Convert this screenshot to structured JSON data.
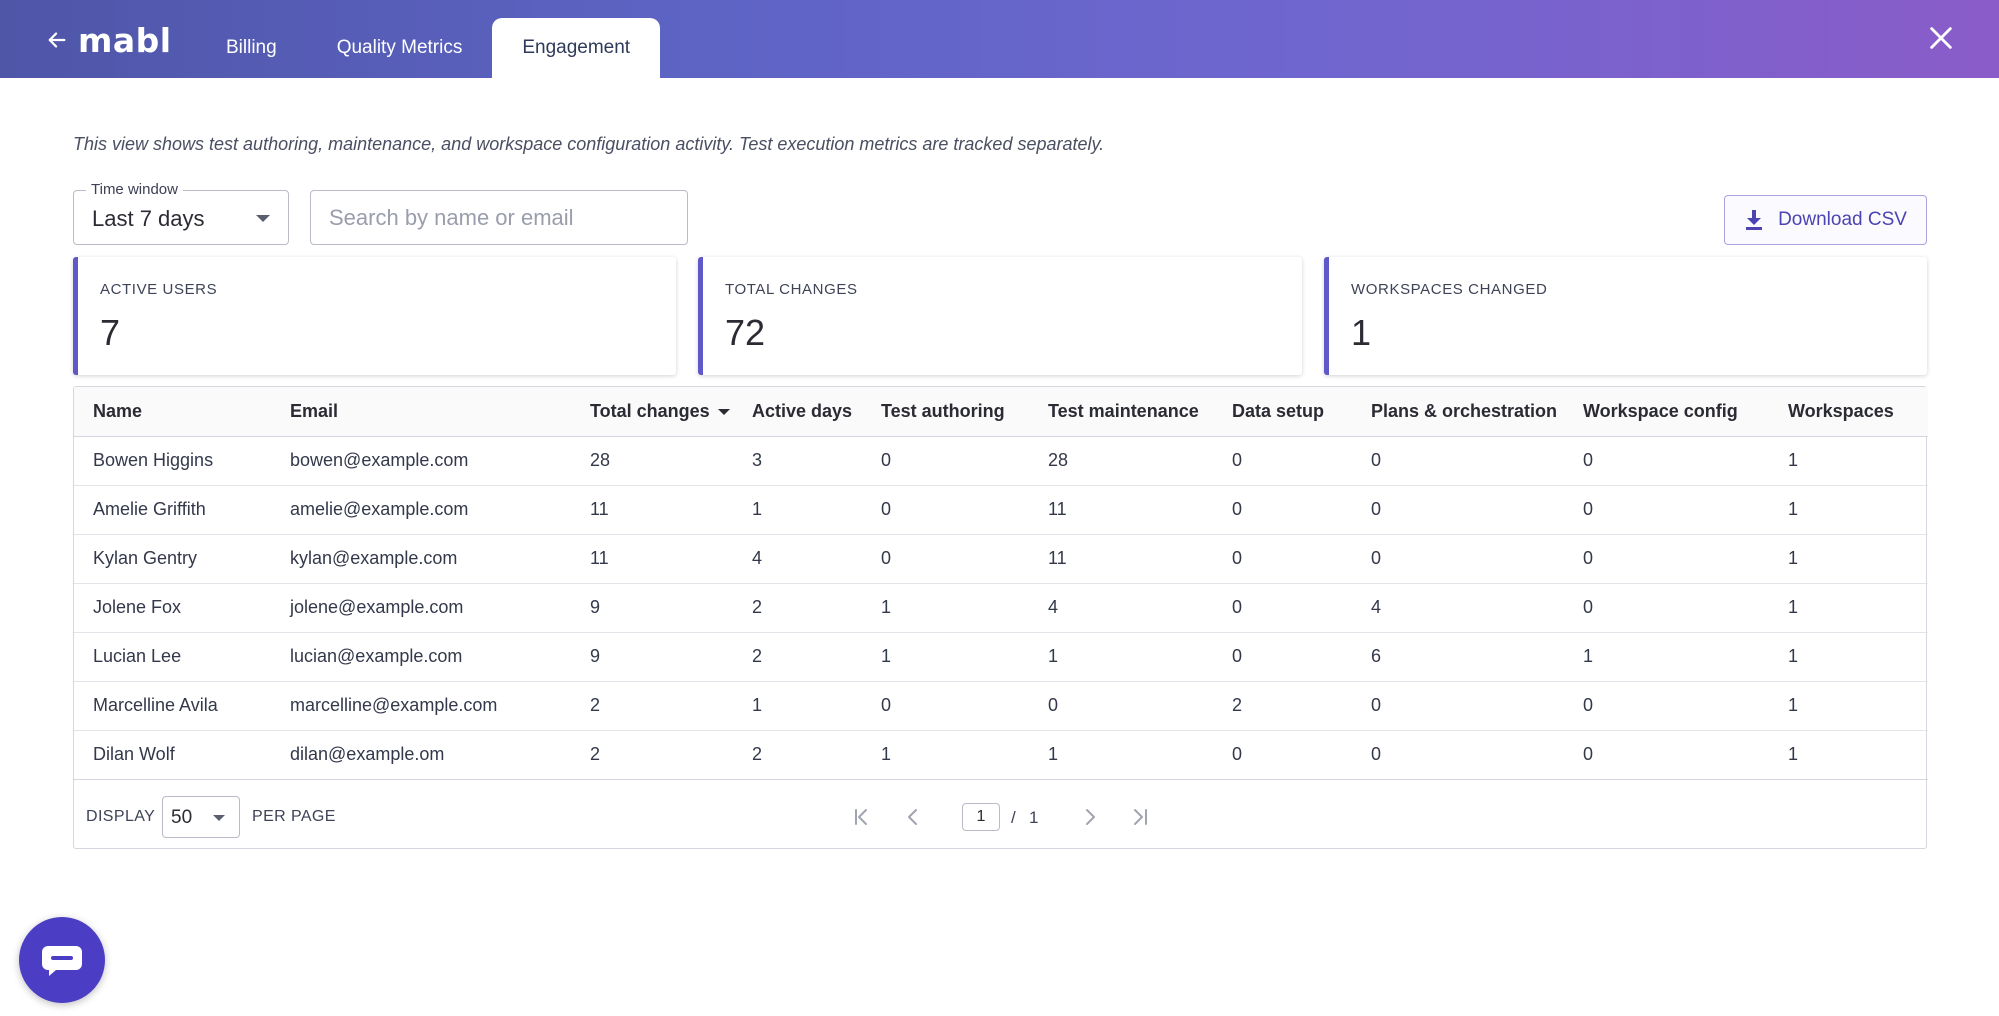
{
  "header": {
    "logo": "mabl",
    "back_icon": "arrow-left-icon",
    "close_icon": "close-icon",
    "tabs": [
      {
        "label": "Billing",
        "active": false
      },
      {
        "label": "Quality Metrics",
        "active": false
      },
      {
        "label": "Engagement",
        "active": true
      }
    ]
  },
  "description": "This view shows test authoring, maintenance, and workspace configuration activity. Test execution metrics are tracked separately.",
  "controls": {
    "time_window_label": "Time window",
    "time_window_value": "Last 7 days",
    "search_placeholder": "Search by name or email",
    "download_label": "Download CSV",
    "download_icon": "download-icon"
  },
  "stats": [
    {
      "label": "ACTIVE USERS",
      "value": "7"
    },
    {
      "label": "TOTAL CHANGES",
      "value": "72"
    },
    {
      "label": "WORKSPACES CHANGED",
      "value": "1"
    }
  ],
  "table": {
    "columns": [
      "Name",
      "Email",
      "Total changes",
      "Active days",
      "Test authoring",
      "Test maintenance",
      "Data setup",
      "Plans & orchestration",
      "Workspace config",
      "Workspaces"
    ],
    "sorted_column": "Total changes",
    "rows": [
      [
        "Bowen Higgins",
        "bowen@example.com",
        "28",
        "3",
        "0",
        "28",
        "0",
        "0",
        "0",
        "1"
      ],
      [
        "Amelie Griffith",
        "amelie@example.com",
        "11",
        "1",
        "0",
        "11",
        "0",
        "0",
        "0",
        "1"
      ],
      [
        "Kylan Gentry",
        "kylan@example.com",
        "11",
        "4",
        "0",
        "11",
        "0",
        "0",
        "0",
        "1"
      ],
      [
        "Jolene Fox",
        "jolene@example.com",
        "9",
        "2",
        "1",
        "4",
        "0",
        "4",
        "0",
        "1"
      ],
      [
        "Lucian Lee",
        "lucian@example.com",
        "9",
        "2",
        "1",
        "1",
        "0",
        "6",
        "1",
        "1"
      ],
      [
        "Marcelline Avila",
        "marcelline@example.com",
        "2",
        "1",
        "0",
        "0",
        "2",
        "0",
        "0",
        "1"
      ],
      [
        "Dilan Wolf",
        "dilan@example.om",
        "2",
        "2",
        "1",
        "1",
        "0",
        "0",
        "0",
        "1"
      ]
    ]
  },
  "pagination": {
    "display_label": "DISPLAY",
    "per_page_value": "50",
    "per_page_label": "PER PAGE",
    "current_page": "1",
    "separator": "/",
    "total_pages": "1"
  },
  "chat": {
    "icon": "chat-icon"
  },
  "colors": {
    "accent": "#5f58c9",
    "header_gradient_start": "#4f56a8",
    "header_gradient_end": "#8a5cc9",
    "chat_button": "#4b3ec4"
  }
}
